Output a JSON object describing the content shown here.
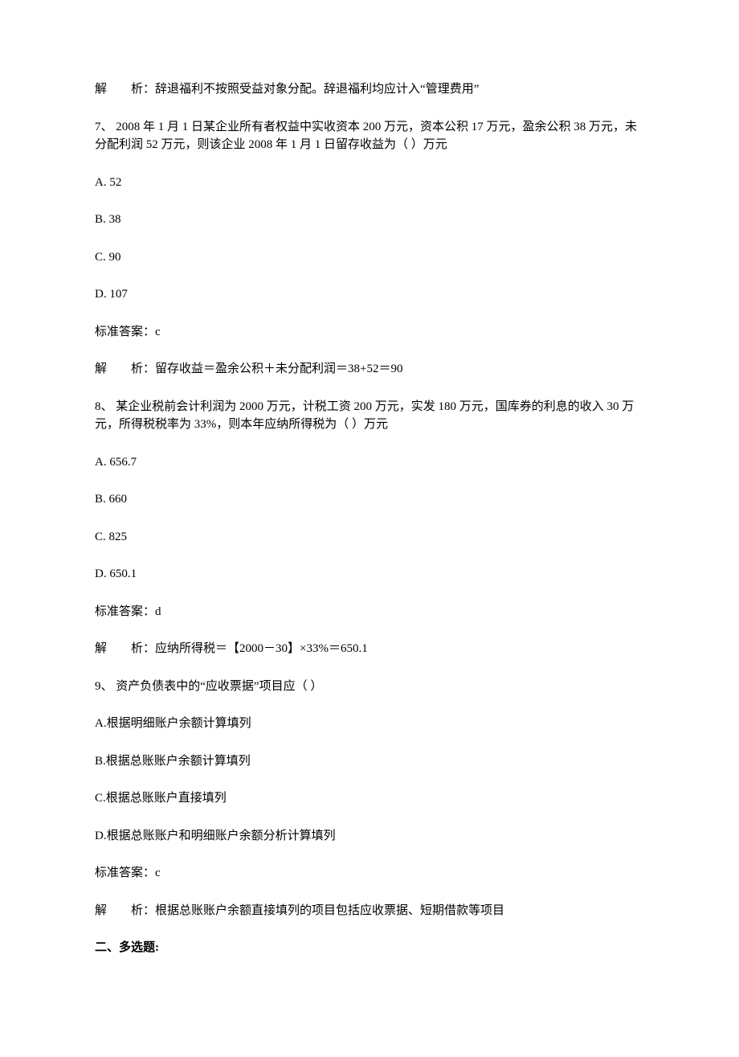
{
  "a6": {
    "label": "解",
    "gap": "　　",
    "text": "析：辞退福利不按照受益对象分配。辞退福利均应计入“管理费用”"
  },
  "q7": {
    "stem": "7、 2008 年 1 月 1 日某企业所有者权益中实收资本 200 万元，资本公积 17 万元，盈余公积 38 万元，未分配利润 52 万元，则该企业 2008 年 1 月 1 日留存收益为（ ）万元",
    "optA": "A. 52",
    "optB": "B. 38",
    "optC": "C. 90",
    "optD": "D. 107",
    "ans": "标准答案：c"
  },
  "a7": {
    "label": "解",
    "gap": "　　",
    "text": "析：留存收益＝盈余公积＋未分配利润＝38+52＝90"
  },
  "q8": {
    "stem": "8、 某企业税前会计利润为 2000 万元，计税工资 200 万元，实发 180 万元，国库券的利息的收入 30 万元，所得税税率为 33%，则本年应纳所得税为（ ）万元",
    "optA": "A. 656.7",
    "optB": "B. 660",
    "optC": "C. 825",
    "optD": "D. 650.1",
    "ans": "标准答案：d"
  },
  "a8": {
    "label": "解",
    "gap": "　　",
    "text": "析：应纳所得税＝【2000－30】×33%＝650.1"
  },
  "q9": {
    "stem": "9、 资产负债表中的“应收票据”项目应（ ）",
    "optA": "A.根据明细账户余额计算填列",
    "optB": "B.根据总账账户余额计算填列",
    "optC": "C.根据总账账户直接填列",
    "optD": "D.根据总账账户和明细账户余额分析计算填列",
    "ans": "标准答案：c"
  },
  "a9": {
    "label": "解",
    "gap": "　　",
    "text": "析：根据总账账户余额直接填列的项目包括应收票据、短期借款等项目"
  },
  "section2": "二、多选题:"
}
